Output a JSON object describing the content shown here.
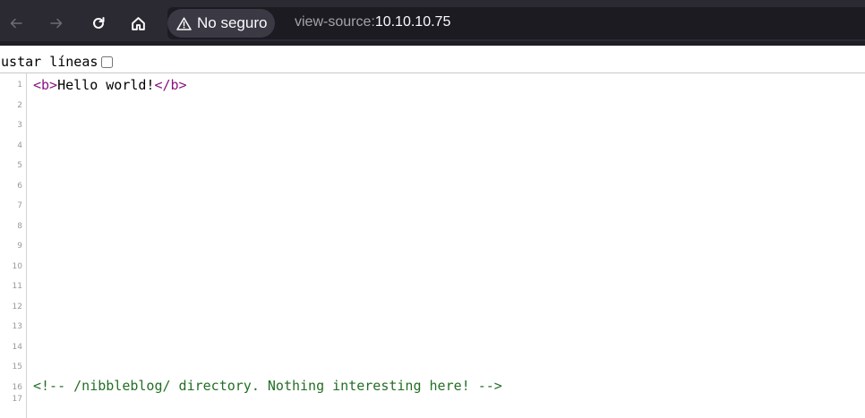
{
  "toolbar": {
    "back_icon": "arrow-left-icon",
    "forward_icon": "arrow-right-icon",
    "reload_icon": "reload-icon",
    "home_icon": "home-icon",
    "security_label": "No seguro",
    "url_scheme": "view-source:",
    "url_host": "10.10.10.75"
  },
  "wrap": {
    "label": "justar líneas",
    "checked": false
  },
  "source": {
    "line_numbers": [
      "1",
      "2",
      "3",
      "4",
      "5",
      "6",
      "7",
      "8",
      "9",
      "10",
      "11",
      "12",
      "13",
      "14",
      "15",
      "16",
      "17"
    ],
    "line1": {
      "open_tag": "<b>",
      "text": "Hello world!",
      "close_tag": "</b>"
    },
    "line16": {
      "comment": "<!-- /nibbleblog/ directory. Nothing interesting here! -->"
    }
  },
  "colors": {
    "toolbar": "#2b2a33",
    "urlbar": "#1c1b22",
    "tag": "#881280",
    "comment": "#236e25"
  }
}
